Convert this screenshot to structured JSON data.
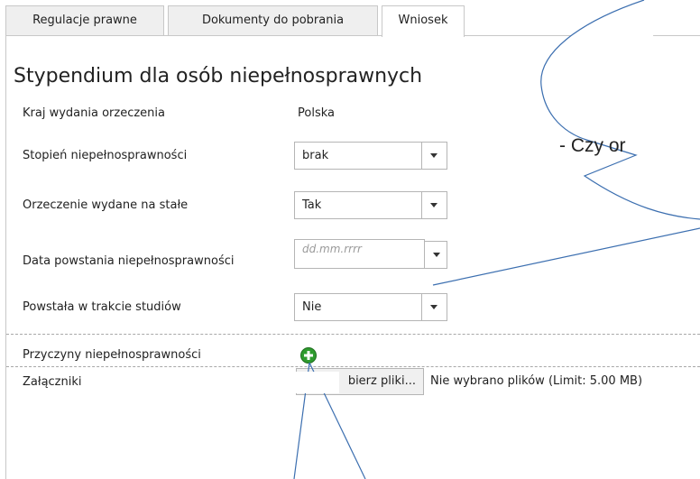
{
  "tabs": [
    {
      "label": "Regulacje prawne"
    },
    {
      "label": "Dokumenty do pobrania"
    },
    {
      "label": "Wniosek",
      "active": true
    }
  ],
  "form": {
    "title": "Stypendium dla osób niepełnosprawnych",
    "fields": {
      "country": {
        "label": "Kraj wydania orzeczenia",
        "value": "Polska"
      },
      "degree": {
        "label": "Stopień niepełnosprawności",
        "value": "brak"
      },
      "permanent": {
        "label": "Orzeczenie wydane na stałe",
        "value": "Tak"
      },
      "onset_date": {
        "label": "Data powstania niepełnosprawności",
        "placeholder": "dd.mm.rrrr"
      },
      "during_studies": {
        "label": "Powstała w trakcie studiów",
        "value": "Nie"
      },
      "causes": {
        "label": "Przyczyny niepełnosprawności"
      },
      "attachments": {
        "label": "Załączniki",
        "button_label": "bierz pliki...",
        "status": "Nie wybrano plików (Limit: 5.00 MB)"
      }
    }
  },
  "annotation": {
    "callout_text": "- Czy or"
  },
  "colors": {
    "tab_bg": "#efefef",
    "border": "#c8c8c8",
    "add_icon": "#2e9b2e",
    "callout_line": "#3c6fb0"
  },
  "icons": {
    "add": "plus-circle-icon",
    "dropdown": "chevron-down-icon"
  }
}
